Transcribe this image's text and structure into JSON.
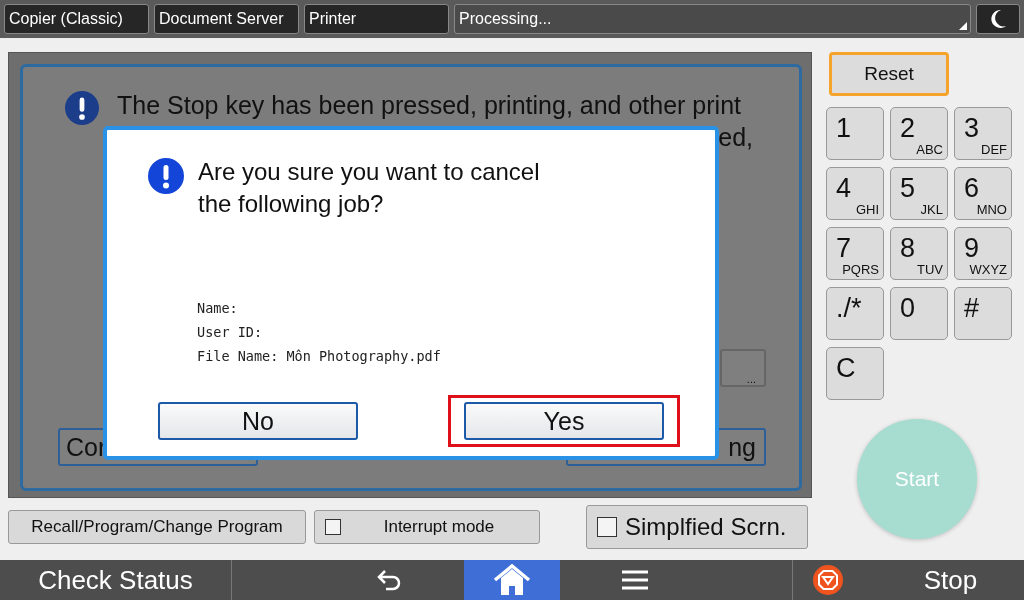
{
  "top_bar": {
    "tabs": [
      "Copier (Classic)",
      "Document Server",
      "Printer"
    ],
    "status": "Processing..."
  },
  "background_dialog": {
    "message": "The Stop key has been pressed, printing, and other print",
    "message_tail": "ed,",
    "more_button": "...",
    "left_button": "Cor",
    "right_button": "ng"
  },
  "confirm_dialog": {
    "question": "Are you sure you want to cancel\nthe following job?",
    "details": [
      "Name:",
      "User ID:",
      "File Name: Môn Photography.pdf"
    ],
    "buttons": [
      {
        "label": "No",
        "highlighted": false
      },
      {
        "label": "Yes",
        "highlighted": true
      }
    ]
  },
  "bottom_controls": [
    {
      "kind": "button",
      "label": "Recall/Program/Change Program"
    },
    {
      "kind": "checkbox",
      "label": "Interrupt mode",
      "checked": false
    },
    {
      "kind": "checkbox-large",
      "label": "Simplfied Scrn.",
      "checked": false
    }
  ],
  "keypad": {
    "reset": "Reset",
    "keys": [
      {
        "main": "1"
      },
      {
        "main": "2",
        "sub": "ABC"
      },
      {
        "main": "3",
        "sub": "DEF"
      },
      {
        "main": "4",
        "sub": "GHI"
      },
      {
        "main": "5",
        "sub": "JKL"
      },
      {
        "main": "6",
        "sub": "MNO"
      },
      {
        "main": "7",
        "sub": "PQRS"
      },
      {
        "main": "8",
        "sub": "TUV"
      },
      {
        "main": "9",
        "sub": "WXYZ"
      },
      {
        "main": "./*"
      },
      {
        "main": "0"
      },
      {
        "main": "#"
      },
      {
        "main": "C"
      }
    ],
    "start": "Start"
  },
  "status_bar": {
    "check_status": "Check Status",
    "stop": "Stop"
  }
}
